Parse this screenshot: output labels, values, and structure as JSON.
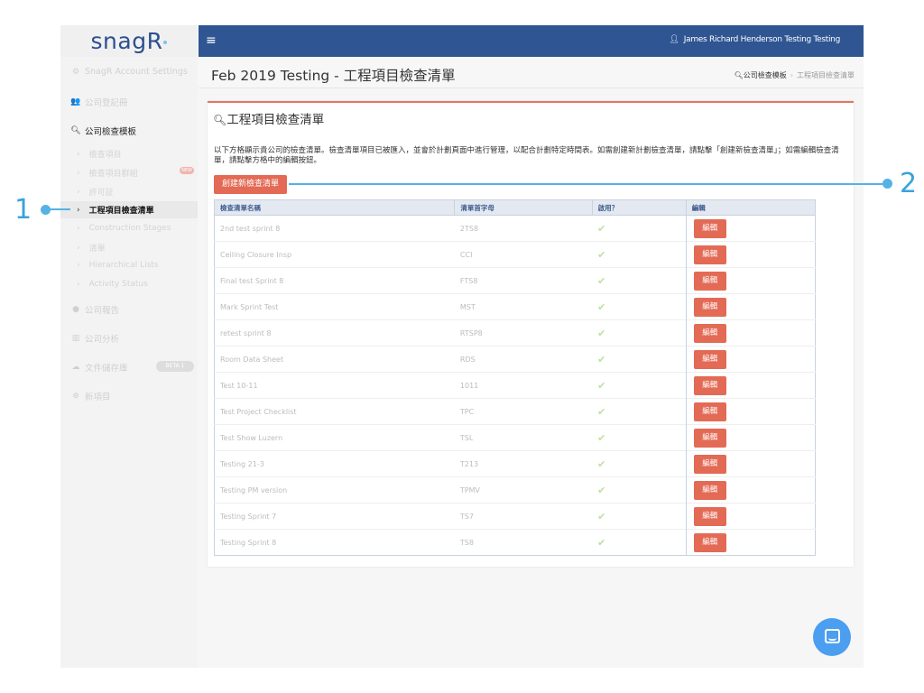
{
  "logo": {
    "text": "snagR"
  },
  "topbar": {
    "menu_icon": "hamburger-icon",
    "user_icon": "user-icon",
    "user_name": "James Richard Henderson Testing Testing"
  },
  "sidebar": {
    "items": [
      {
        "label": "SnagR Account Settings",
        "icon": "cogs-icon"
      },
      {
        "label": "公司登記冊",
        "icon": "users-icon"
      },
      {
        "label": "公司檢查模板",
        "icon": "search-icon"
      },
      {
        "label": "公司報告",
        "icon": "globe-icon"
      },
      {
        "label": "公司分析",
        "icon": "bar-chart-icon"
      },
      {
        "label": "文件儲存庫",
        "icon": "cloud-icon"
      },
      {
        "label": "新項目",
        "icon": "plus-circle-icon"
      }
    ],
    "subitems": [
      {
        "label": "檢查項目"
      },
      {
        "label": "檢查項目群組",
        "badge": "NEW"
      },
      {
        "label": "許可証"
      },
      {
        "label": "工程項目檢查清單"
      },
      {
        "label": "Construction Stages"
      },
      {
        "label": "清單"
      },
      {
        "label": "Hierarchical Lists"
      },
      {
        "label": "Activity Status"
      }
    ],
    "doc_store_badge": "BETA 1"
  },
  "header": {
    "title": "Feb 2019 Testing - 工程項目檢查清單"
  },
  "breadcrumb": {
    "first": "公司檢查模板",
    "sep": "›",
    "current": "工程項目檢查清單"
  },
  "panel": {
    "title": "工程項目檢查清單",
    "description": "以下方格顯示貴公司的檢查清單。檢查清單項目已被匯入，並會於計劃頁面中進行管理，以配合計劃特定時間表。如需創建新計劃檢查清單，請點擊「創建新檢查清單」；如需編輯檢查清單，請點擊方格中的編輯按鈕。",
    "create_button": "創建新檢查清單"
  },
  "table": {
    "headers": [
      "檢查清單名稱",
      "清單首字母",
      "啟用？",
      "編輯"
    ],
    "edit_label": "編輯",
    "rows": [
      {
        "name": "2nd test sprint 8",
        "initials": "2TS8"
      },
      {
        "name": "Ceiling Closure Insp",
        "initials": "CCI"
      },
      {
        "name": "Final test Sprint 8",
        "initials": "FTS8"
      },
      {
        "name": "Mark Sprint Test",
        "initials": "MST"
      },
      {
        "name": "retest sprint 8",
        "initials": "RTSP8"
      },
      {
        "name": "Room Data Sheet",
        "initials": "RDS"
      },
      {
        "name": "Test 10-11",
        "initials": "1011"
      },
      {
        "name": "Test Project Checklist",
        "initials": "TPC"
      },
      {
        "name": "Test Show Luzern",
        "initials": "TSL"
      },
      {
        "name": "Testing 21-3",
        "initials": "T213"
      },
      {
        "name": "Testing PM version",
        "initials": "TPMV"
      },
      {
        "name": "Testing Sprint 7",
        "initials": "TS7"
      },
      {
        "name": "Testing Sprint 8",
        "initials": "TS8"
      }
    ]
  },
  "callouts": {
    "one": "1",
    "two": "2"
  },
  "colors": {
    "topbar": "#2f5592",
    "accent": "#e36a55",
    "callout": "#3aa2dc",
    "chat": "#4b9ef0"
  }
}
